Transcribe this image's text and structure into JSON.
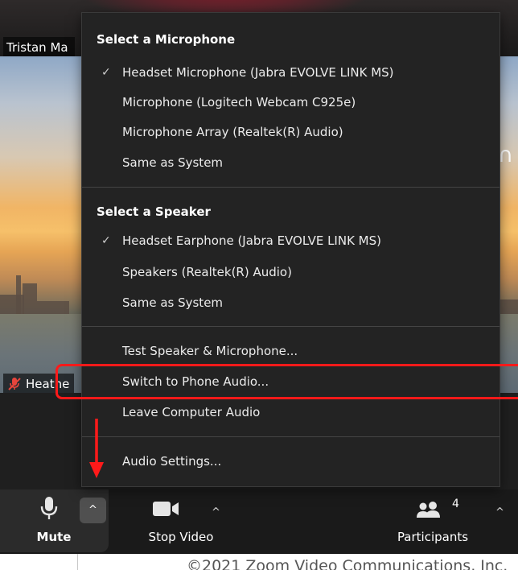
{
  "window": {
    "top_participant_name": "Tristan Ma",
    "bottom_participant_name": "Heathe",
    "right_logo_glyph": "∩"
  },
  "audio_menu": {
    "microphone_section_title": "Select a Microphone",
    "microphones": [
      {
        "label": "Headset Microphone (Jabra EVOLVE LINK MS)",
        "selected": true
      },
      {
        "label": "Microphone (Logitech Webcam C925e)",
        "selected": false
      },
      {
        "label": "Microphone Array (Realtek(R) Audio)",
        "selected": false
      },
      {
        "label": "Same as System",
        "selected": false
      }
    ],
    "speaker_section_title": "Select a Speaker",
    "speakers": [
      {
        "label": "Headset Earphone (Jabra EVOLVE LINK MS)",
        "selected": true
      },
      {
        "label": "Speakers (Realtek(R) Audio)",
        "selected": false
      },
      {
        "label": "Same as System",
        "selected": false
      }
    ],
    "actions": [
      {
        "label": "Test Speaker & Microphone..."
      },
      {
        "label": "Switch to Phone Audio..."
      },
      {
        "label": "Leave Computer Audio"
      }
    ],
    "settings_label": "Audio Settings...",
    "check_glyph": "✓"
  },
  "toolbar": {
    "mute_label": "Mute",
    "stop_video_label": "Stop Video",
    "participants_label": "Participants",
    "participants_count": "4",
    "chevron_glyph": "^"
  },
  "footer": {
    "copyright": "©2021 Zoom Video Communications, Inc."
  },
  "colors": {
    "menu_background": "#232323",
    "toolbar_background": "#1a1a1a",
    "annotation_red": "#ff1a1a",
    "muted_icon_red": "#e8453c"
  },
  "icons": {
    "microphone": "microphone-icon",
    "muted_microphone": "muted-microphone-icon",
    "camera": "camera-icon",
    "participants": "participants-icon",
    "chevron": "chevron-up-icon",
    "check": "checkmark-icon"
  }
}
